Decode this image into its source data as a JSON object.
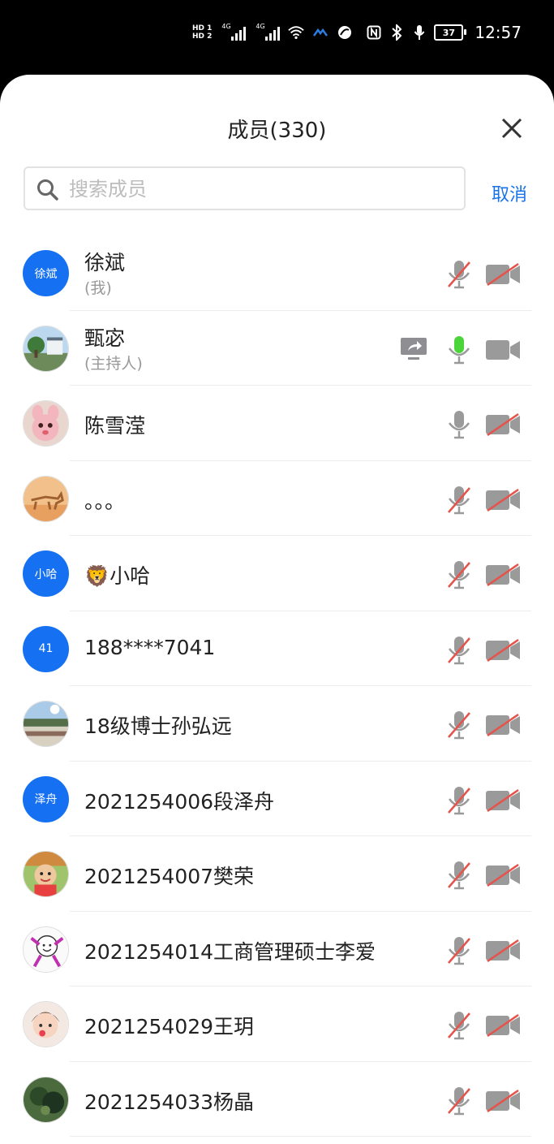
{
  "status_bar": {
    "hd1": "HD 1",
    "hd2": "HD 2",
    "net1": "4G",
    "net2": "4G",
    "battery": "37",
    "time": "12:57"
  },
  "header": {
    "title": "成员(330)",
    "close_icon": "close-icon"
  },
  "search": {
    "placeholder": "搜索成员",
    "value": "",
    "cancel_label": "取消"
  },
  "members": [
    {
      "name": "徐斌",
      "sub": "(我)",
      "avatar_text": "徐斌",
      "avatar_type": "blue",
      "mic": "muted",
      "cam": "off",
      "sharing": false
    },
    {
      "name": "甄宓",
      "sub": "(主持人)",
      "avatar_text": "",
      "avatar_type": "photo-landscape",
      "mic": "active",
      "cam": "on",
      "sharing": true
    },
    {
      "name": "陈雪滢",
      "sub": "",
      "avatar_text": "",
      "avatar_type": "photo-pink",
      "mic": "on",
      "cam": "off",
      "sharing": false
    },
    {
      "name": "。。。",
      "sub": "",
      "avatar_text": "",
      "avatar_type": "photo-orange",
      "mic": "muted",
      "cam": "off",
      "sharing": false
    },
    {
      "name": "🦁小哈",
      "sub": "",
      "avatar_text": "小哈",
      "avatar_type": "blue",
      "mic": "muted",
      "cam": "off",
      "sharing": false
    },
    {
      "name": "188****7041",
      "sub": "",
      "avatar_text": "41",
      "avatar_type": "blue",
      "mic": "muted",
      "cam": "off",
      "sharing": false
    },
    {
      "name": "18级博士孙弘远",
      "sub": "",
      "avatar_text": "",
      "avatar_type": "photo-beach",
      "mic": "muted",
      "cam": "off",
      "sharing": false
    },
    {
      "name": "2021254006段泽舟",
      "sub": "",
      "avatar_text": "泽舟",
      "avatar_type": "blue",
      "mic": "muted",
      "cam": "off",
      "sharing": false
    },
    {
      "name": "2021254007樊荣",
      "sub": "",
      "avatar_text": "",
      "avatar_type": "photo-child",
      "mic": "muted",
      "cam": "off",
      "sharing": false
    },
    {
      "name": "2021254014工商管理硕士李爱",
      "sub": "",
      "avatar_text": "",
      "avatar_type": "photo-cartoon",
      "mic": "muted",
      "cam": "off",
      "sharing": false
    },
    {
      "name": "2021254029王玥",
      "sub": "",
      "avatar_text": "",
      "avatar_type": "photo-girl",
      "mic": "muted",
      "cam": "off",
      "sharing": false
    },
    {
      "name": "2021254033杨晶",
      "sub": "",
      "avatar_text": "",
      "avatar_type": "photo-dark",
      "mic": "muted",
      "cam": "off",
      "sharing": false
    }
  ],
  "colors": {
    "accent": "#1a73e8",
    "avatar_blue": "#1671f2",
    "muted_red": "#e5534b",
    "mic_active": "#4cd43b",
    "icon_gray": "#8e8e93"
  }
}
